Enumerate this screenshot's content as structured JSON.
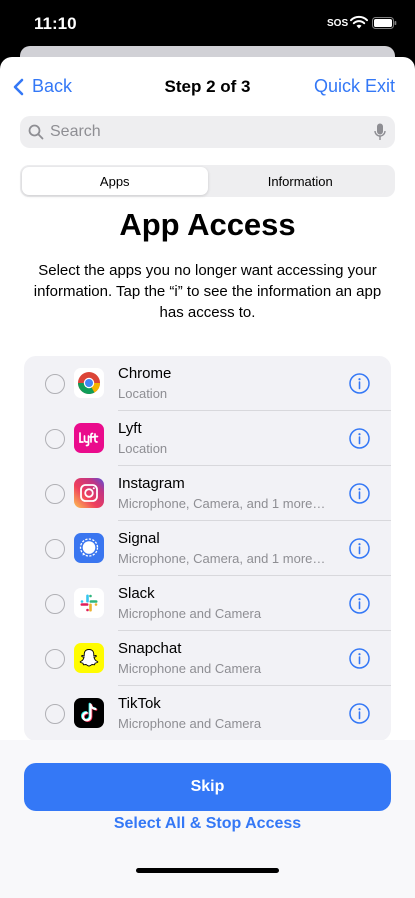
{
  "status": {
    "time": "11:10",
    "sos": "SOS"
  },
  "nav": {
    "back_label": "Back",
    "title": "Step 2 of 3",
    "quick_exit_label": "Quick Exit"
  },
  "search": {
    "placeholder": "Search"
  },
  "tabs": [
    {
      "label": "Apps",
      "selected": true
    },
    {
      "label": "Information",
      "selected": false
    }
  ],
  "heading": "App Access",
  "description": "Select the apps you no longer want accessing your information. Tap the “i” to see the information an app has access to.",
  "apps": [
    {
      "name": "Chrome",
      "detail": "Location",
      "icon": "chrome-icon"
    },
    {
      "name": "Lyft",
      "detail": "Location",
      "icon": "lyft-icon"
    },
    {
      "name": "Instagram",
      "detail": "Microphone, Camera, and 1 more…",
      "icon": "instagram-icon"
    },
    {
      "name": "Signal",
      "detail": "Microphone, Camera, and 1 more…",
      "icon": "signal-icon"
    },
    {
      "name": "Slack",
      "detail": "Microphone and Camera",
      "icon": "slack-icon"
    },
    {
      "name": "Snapchat",
      "detail": "Microphone and Camera",
      "icon": "snapchat-icon"
    },
    {
      "name": "TikTok",
      "detail": "Microphone and Camera",
      "icon": "tiktok-icon"
    }
  ],
  "actions": {
    "skip_label": "Skip",
    "select_all_label": "Select All & Stop Access"
  },
  "colors": {
    "accent": "#3478f6",
    "list_background": "#f2f2f6",
    "secondary_text": "#8e8e93"
  }
}
